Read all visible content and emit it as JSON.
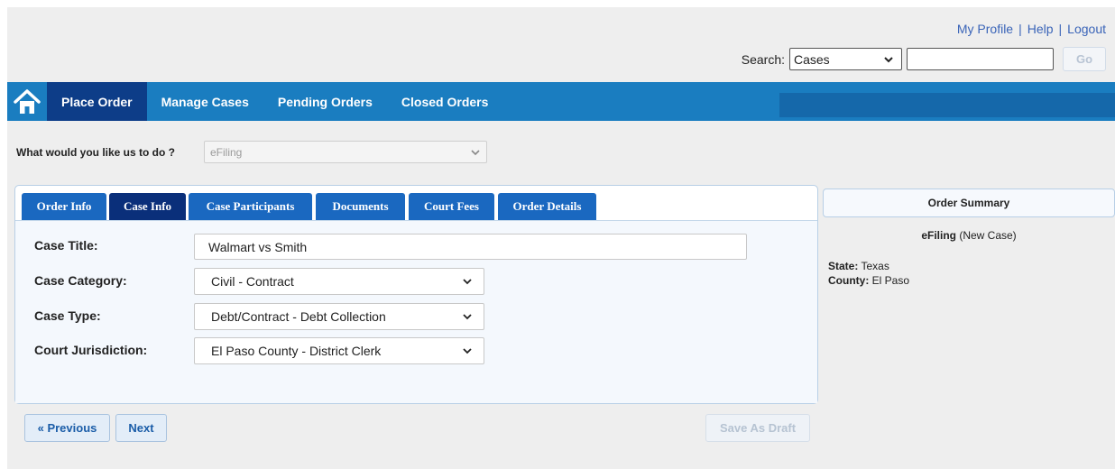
{
  "header": {
    "links": [
      "My Profile",
      "Help",
      "Logout"
    ],
    "search_label": "Search:",
    "search_scope": "Cases",
    "search_value": "",
    "go_label": "Go"
  },
  "nav": {
    "items": [
      "Place Order",
      "Manage Cases",
      "Pending Orders",
      "Closed Orders"
    ],
    "active": "Place Order"
  },
  "question": {
    "label": "What would you like us to do ?",
    "value": "eFiling"
  },
  "tabs": [
    "Order Info",
    "Case Info",
    "Case Participants",
    "Documents",
    "Court Fees",
    "Order Details"
  ],
  "active_tab": "Case Info",
  "form": {
    "case_title_label": "Case Title:",
    "case_title_value": "Walmart vs Smith",
    "case_category_label": "Case Category:",
    "case_category_value": "Civil - Contract",
    "case_type_label": "Case Type:",
    "case_type_value": "Debt/Contract - Debt Collection",
    "court_jurisdiction_label": "Court Jurisdiction:",
    "court_jurisdiction_value": "El Paso County - District Clerk"
  },
  "buttons": {
    "previous": "« Previous",
    "next": "Next",
    "save_draft": "Save As Draft"
  },
  "summary": {
    "title": "Order Summary",
    "service": "eFiling",
    "service_note": "(New Case)",
    "state_label": "State:",
    "state_value": "Texas",
    "county_label": "County:",
    "county_value": "El Paso"
  },
  "colors": {
    "nav_bar": "#1a7dc0",
    "nav_active": "#0d3d88",
    "tab": "#1a68c0",
    "tab_active": "#0a2f7a",
    "link": "#3a64b8"
  }
}
